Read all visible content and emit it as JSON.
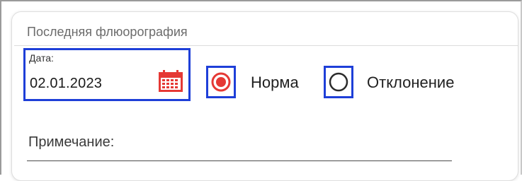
{
  "card": {
    "title": "Последняя флюорография"
  },
  "date_field": {
    "label": "Дата:",
    "value": "02.01.2023",
    "icon": "calendar-icon"
  },
  "radio_group": {
    "options": [
      {
        "label": "Норма",
        "selected": true
      },
      {
        "label": "Отклонение",
        "selected": false
      }
    ]
  },
  "note_field": {
    "label": "Примечание:",
    "value": ""
  },
  "colors": {
    "highlight": "#1e3fd8",
    "accent": "#e53935",
    "text": "#1f1f1f",
    "muted": "#6b6b6b"
  }
}
